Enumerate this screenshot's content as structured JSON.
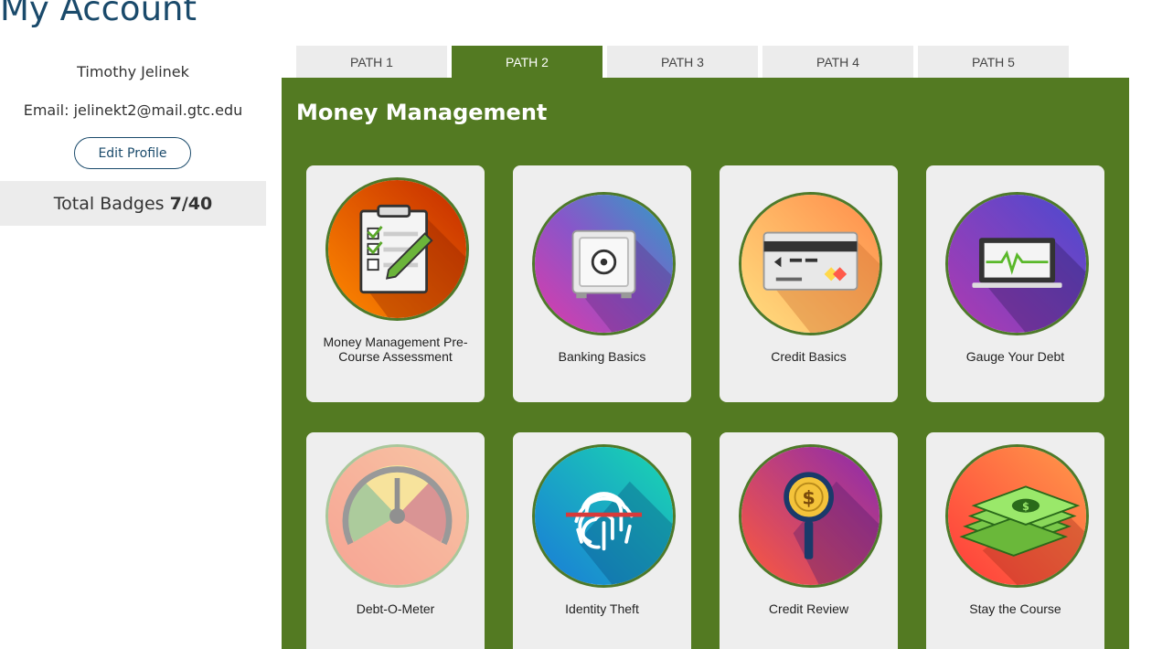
{
  "page": {
    "title": "My Account"
  },
  "profile": {
    "name": "Timothy Jelinek",
    "email": "Email: jelinekt2@mail.gtc.edu",
    "edit_label": "Edit Profile",
    "badges_label": "Total Badges",
    "badges_count": "7/40"
  },
  "tabs": [
    {
      "label": "PATH 1",
      "active": false
    },
    {
      "label": "PATH 2",
      "active": true
    },
    {
      "label": "PATH 3",
      "active": false
    },
    {
      "label": "PATH 4",
      "active": false
    },
    {
      "label": "PATH 5",
      "active": false
    }
  ],
  "panel": {
    "title": "Money Management",
    "accent_color": "#537a22",
    "cards": [
      {
        "label": "Money Management Pre-Course Assessment",
        "icon": "clipboard-checklist-icon",
        "earned": true
      },
      {
        "label": "Banking Basics",
        "icon": "safe-icon",
        "earned": true
      },
      {
        "label": "Credit Basics",
        "icon": "credit-card-icon",
        "earned": true
      },
      {
        "label": "Gauge Your Debt",
        "icon": "laptop-chart-icon",
        "earned": true
      },
      {
        "label": "Debt-O-Meter",
        "icon": "gauge-meter-icon",
        "earned": false
      },
      {
        "label": "Identity Theft",
        "icon": "fingerprint-icon",
        "earned": true
      },
      {
        "label": "Credit Review",
        "icon": "magnifier-dollar-icon",
        "earned": true
      },
      {
        "label": "Stay the Course",
        "icon": "money-stack-icon",
        "earned": true
      }
    ]
  }
}
